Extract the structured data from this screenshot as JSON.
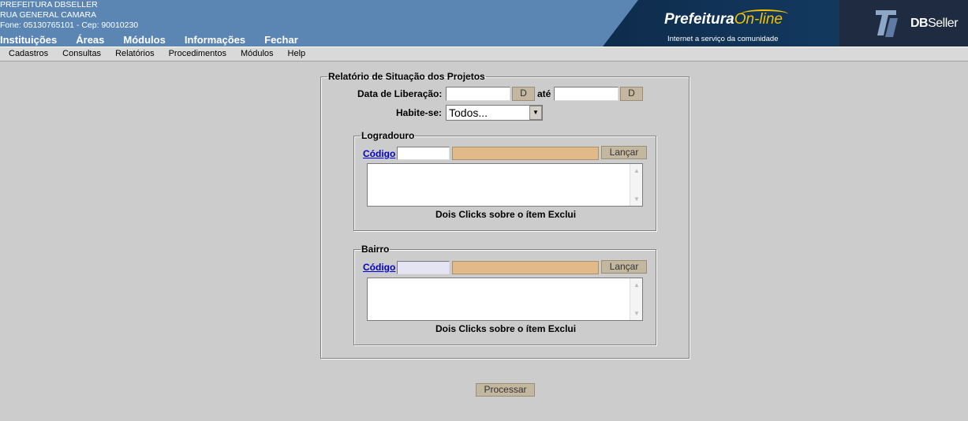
{
  "header": {
    "org_name": "PREFEITURA DBSELLER",
    "address": "RUA GENERAL CAMARA",
    "contact": "Fone: 05130765101  -  Cep: 90010230",
    "nav": [
      "Instituições",
      "Áreas",
      "Módulos",
      "Informações",
      "Fechar"
    ],
    "brand_prefeitura": "Prefeitura",
    "brand_online": "On-line",
    "brand_tagline": "Internet a serviço da comunidade",
    "brand_db": "DB",
    "brand_seller": "Seller"
  },
  "menu": [
    "Cadastros",
    "Consultas",
    "Relatórios",
    "Procedimentos",
    "Módulos",
    "Help"
  ],
  "form": {
    "legend": "Relatório de Situação dos Projetos",
    "data_label": "Data de Liberação:",
    "date_from_value": "",
    "date_button": "D",
    "ate_label": "até",
    "date_to_value": "",
    "habite_label": "Habite-se:",
    "habite_selected": "Todos...",
    "logradouro": {
      "legend": "Logradouro",
      "code_link": "Código",
      "code_value": "",
      "launch_button": "Lançar",
      "note": "Dois Clicks sobre o ítem Exclui"
    },
    "bairro": {
      "legend": "Bairro",
      "code_link": "Código",
      "code_value": "",
      "launch_button": "Lançar",
      "note": "Dois Clicks sobre o ítem Exclui"
    },
    "process_button": "Processar"
  },
  "colors": {
    "header_blue": "#5b86b3",
    "button_tan": "#c4b79f",
    "desc_field": "#e2ba8a",
    "link_blue": "#0000cc"
  }
}
